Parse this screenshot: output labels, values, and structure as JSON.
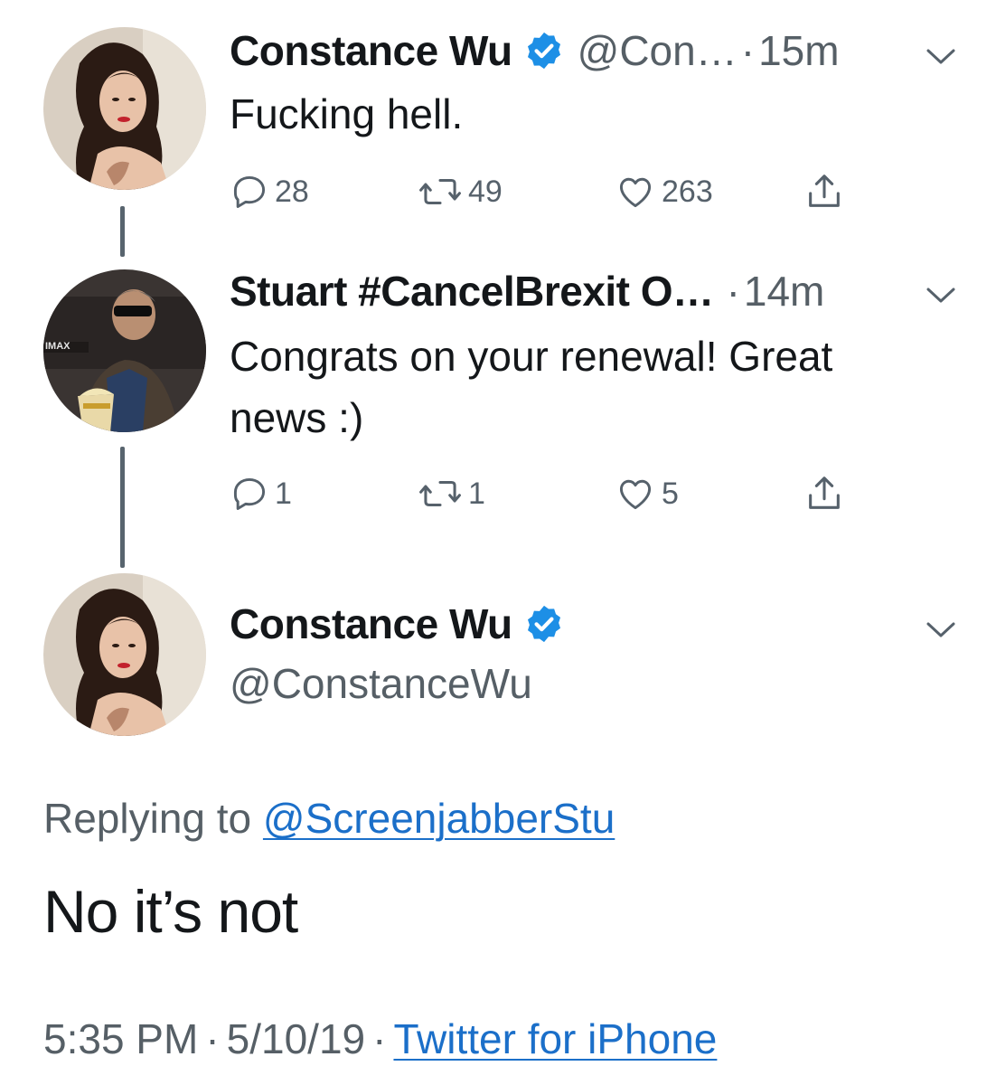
{
  "tweets": [
    {
      "name": "Constance Wu",
      "verified": true,
      "handle": "@Con…",
      "dot": "·",
      "time": "15m",
      "text": "Fucking hell.",
      "replies": "28",
      "retweets": "49",
      "likes": "263"
    },
    {
      "name": "Stuart #CancelBrexit O…",
      "verified": false,
      "dot": "·",
      "time": "14m",
      "text_line1": "Congrats on your renewal! Great",
      "text_line2": "news :)",
      "replies": "1",
      "retweets": "1",
      "likes": "5"
    }
  ],
  "main_tweet": {
    "name": "Constance Wu",
    "verified": true,
    "handle": "@ConstanceWu",
    "replying_prefix": "Replying to",
    "replying_to": "@ScreenjabberStu",
    "text": "No it’s not",
    "time": "5:35 PM",
    "date": "5/10/19",
    "separator": "·",
    "source": "Twitter for iPhone"
  },
  "icons": {
    "reply": "reply-icon",
    "retweet": "retweet-icon",
    "like": "heart-icon",
    "share": "share-icon",
    "more": "chevron-down-icon",
    "verified": "verified-badge-icon"
  },
  "colors": {
    "verified_badge": "#1d8fe6",
    "link": "#1b6fc9",
    "secondary_text": "#565f66",
    "thread_line": "#58646e"
  }
}
